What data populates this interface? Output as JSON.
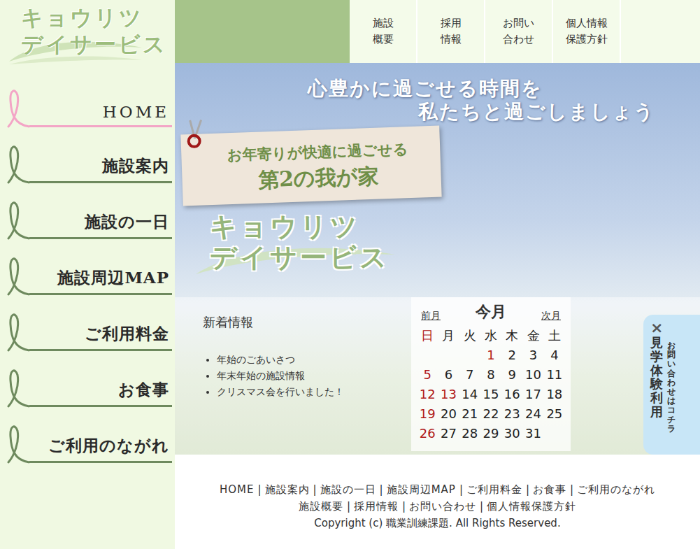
{
  "logo": {
    "lines": [
      "キョウリツ",
      "デイサービス"
    ]
  },
  "topNav": [
    {
      "lines": [
        "施設",
        "概要"
      ]
    },
    {
      "lines": [
        "採用",
        "情報"
      ]
    },
    {
      "lines": [
        "お問い",
        "合わせ"
      ]
    },
    {
      "lines": [
        "個人情報",
        "保護方針"
      ]
    }
  ],
  "sideNav": [
    {
      "label": "HOME",
      "selected": true
    },
    {
      "label": "施設案内",
      "selected": false
    },
    {
      "label": "施設の一日",
      "selected": false
    },
    {
      "label": "施設周辺MAP",
      "selected": false
    },
    {
      "label": "ご利用料金",
      "selected": false
    },
    {
      "label": "お食事",
      "selected": false
    },
    {
      "label": "ご利用のながれ",
      "selected": false
    }
  ],
  "hero": {
    "headline": [
      "心豊かに過ごせる時間を",
      "私たちと過ごしましょう"
    ],
    "tag": [
      "お年寄りが快適に過ごせる",
      "第2の我が家"
    ],
    "logo": [
      "キョウリツ",
      "デイサービス"
    ]
  },
  "news": {
    "title": "新着情報",
    "items": [
      "年始のごあいさつ",
      "年末年始の施設情報",
      "クリスマス会を行いました！"
    ]
  },
  "calendar": {
    "prev": "前月",
    "current": "今月",
    "next": "次月",
    "weekdays": [
      {
        "label": "日",
        "holiday": true
      },
      {
        "label": "月",
        "holiday": false
      },
      {
        "label": "火",
        "holiday": false
      },
      {
        "label": "水",
        "holiday": false
      },
      {
        "label": "木",
        "holiday": false
      },
      {
        "label": "金",
        "holiday": false
      },
      {
        "label": "土",
        "holiday": false
      }
    ],
    "weeks": [
      [
        {
          "day": "",
          "holiday": false
        },
        {
          "day": "",
          "holiday": false
        },
        {
          "day": "",
          "holiday": false
        },
        {
          "day": "1",
          "holiday": true
        },
        {
          "day": "2",
          "holiday": false
        },
        {
          "day": "3",
          "holiday": false
        },
        {
          "day": "4",
          "holiday": false
        }
      ],
      [
        {
          "day": "5",
          "holiday": true
        },
        {
          "day": "6",
          "holiday": false
        },
        {
          "day": "7",
          "holiday": false
        },
        {
          "day": "8",
          "holiday": false
        },
        {
          "day": "9",
          "holiday": false
        },
        {
          "day": "10",
          "holiday": false
        },
        {
          "day": "11",
          "holiday": false
        }
      ],
      [
        {
          "day": "12",
          "holiday": true
        },
        {
          "day": "13",
          "holiday": true
        },
        {
          "day": "14",
          "holiday": false
        },
        {
          "day": "15",
          "holiday": false
        },
        {
          "day": "16",
          "holiday": false
        },
        {
          "day": "17",
          "holiday": false
        },
        {
          "day": "18",
          "holiday": false
        }
      ],
      [
        {
          "day": "19",
          "holiday": true
        },
        {
          "day": "20",
          "holiday": false
        },
        {
          "day": "21",
          "holiday": false
        },
        {
          "day": "22",
          "holiday": false
        },
        {
          "day": "23",
          "holiday": false
        },
        {
          "day": "24",
          "holiday": false
        },
        {
          "day": "25",
          "holiday": false
        }
      ],
      [
        {
          "day": "26",
          "holiday": true
        },
        {
          "day": "27",
          "holiday": false
        },
        {
          "day": "28",
          "holiday": false
        },
        {
          "day": "29",
          "holiday": false
        },
        {
          "day": "30",
          "holiday": false
        },
        {
          "day": "31",
          "holiday": false
        },
        {
          "day": "",
          "holiday": false
        }
      ]
    ]
  },
  "sideTab": {
    "close": "×",
    "title": "見学・体験利用",
    "subtitle": "お問い合わせはコチラ"
  },
  "footer": {
    "rows": [
      [
        "HOME",
        "施設案内",
        "施設の一日",
        "施設周辺MAP",
        "ご利用料金",
        "お食事",
        "ご利用のながれ"
      ],
      [
        "施設概要",
        "採用情報",
        "お問い合わせ",
        "個人情報保護方針"
      ]
    ],
    "separator": "|",
    "copyright": "Copyright (c) 職業訓練課題. All Rights Reserved."
  }
}
